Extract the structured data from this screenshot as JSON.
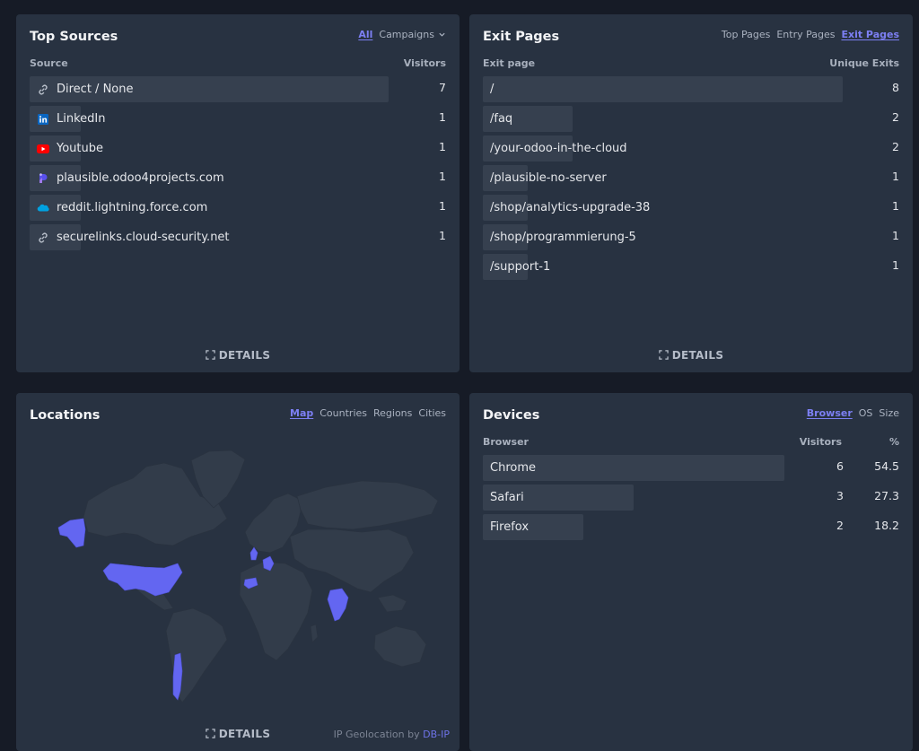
{
  "top_sources": {
    "title": "Top Sources",
    "tabs": [
      {
        "label": "All",
        "active": true
      },
      {
        "label": "Campaigns",
        "active": false
      }
    ],
    "col_source": "Source",
    "col_visitors": "Visitors",
    "rows": [
      {
        "label": "Direct / None",
        "value": "7",
        "icon": "link-icon",
        "share": 1.0
      },
      {
        "label": "LinkedIn",
        "value": "1",
        "icon": "linkedin-icon",
        "share": 0.143
      },
      {
        "label": "Youtube",
        "value": "1",
        "icon": "youtube-icon",
        "share": 0.143
      },
      {
        "label": "plausible.odoo4projects.com",
        "value": "1",
        "icon": "plausible-icon",
        "share": 0.143
      },
      {
        "label": "reddit.lightning.force.com",
        "value": "1",
        "icon": "salesforce-icon",
        "share": 0.143
      },
      {
        "label": "securelinks.cloud-security.net",
        "value": "1",
        "icon": "link-icon",
        "share": 0.143
      }
    ],
    "details": "DETAILS"
  },
  "exit_pages": {
    "title": "Exit Pages",
    "tabs": [
      {
        "label": "Top Pages",
        "active": false
      },
      {
        "label": "Entry Pages",
        "active": false
      },
      {
        "label": "Exit Pages",
        "active": true
      }
    ],
    "col_page": "Exit page",
    "col_exits": "Unique Exits",
    "rows": [
      {
        "label": "/",
        "value": "8",
        "share": 1.0
      },
      {
        "label": "/faq",
        "value": "2",
        "share": 0.25
      },
      {
        "label": "/your-odoo-in-the-cloud",
        "value": "2",
        "share": 0.25
      },
      {
        "label": "/plausible-no-server",
        "value": "1",
        "share": 0.125
      },
      {
        "label": "/shop/analytics-upgrade-38",
        "value": "1",
        "share": 0.125
      },
      {
        "label": "/shop/programmierung-5",
        "value": "1",
        "share": 0.125
      },
      {
        "label": "/support-1",
        "value": "1",
        "share": 0.125
      }
    ],
    "details": "DETAILS"
  },
  "locations": {
    "title": "Locations",
    "tabs": [
      {
        "label": "Map",
        "active": true
      },
      {
        "label": "Countries",
        "active": false
      },
      {
        "label": "Regions",
        "active": false
      },
      {
        "label": "Cities",
        "active": false
      }
    ],
    "details": "DETAILS",
    "geo_prefix": "IP Geolocation by",
    "geo_link": "DB-IP"
  },
  "devices": {
    "title": "Devices",
    "tabs": [
      {
        "label": "Browser",
        "active": true
      },
      {
        "label": "OS",
        "active": false
      },
      {
        "label": "Size",
        "active": false
      }
    ],
    "col_browser": "Browser",
    "col_visitors": "Visitors",
    "col_percent": "%",
    "rows": [
      {
        "label": "Chrome",
        "visitors": "6",
        "percent": "54.5",
        "share": 1.0
      },
      {
        "label": "Safari",
        "visitors": "3",
        "percent": "27.3",
        "share": 0.5
      },
      {
        "label": "Firefox",
        "visitors": "2",
        "percent": "18.2",
        "share": 0.333
      }
    ]
  },
  "colors": {
    "accent": "#7c7ff3",
    "card": "#283241",
    "bar": "#36404f",
    "background": "#161b26",
    "map_land": "#323c4a",
    "map_highlight": "#6366f1"
  }
}
